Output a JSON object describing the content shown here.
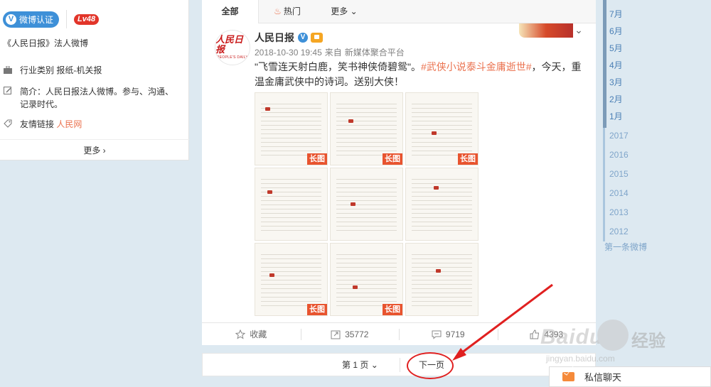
{
  "profile": {
    "verify_label": "微博认证",
    "level": "Lv48",
    "legal_desc": "《人民日报》法人微博",
    "industry_label": "行业类别",
    "industry_value": "报纸-机关报",
    "intro_label": "简介：",
    "intro_value": "人民日报法人微博。参与、沟通、记录时代。",
    "link_label": "友情链接",
    "link_value": "人民网",
    "more_label": "更多"
  },
  "tabs": [
    {
      "label": "全部"
    },
    {
      "label": "热门"
    },
    {
      "label": "更多"
    }
  ],
  "post": {
    "author": "人民日报",
    "avatar_logo": "人民日报",
    "avatar_sub": "PEOPLE'S DAILY",
    "time": "2018-10-30 19:45",
    "source_prefix": "来自",
    "source": "新媒体聚合平台",
    "text_before": "\"飞雪连天射白鹿，笑书神侠倚碧鸳\"。",
    "text_tag": "#武侠小说泰斗金庸逝世#",
    "text_after": "，今天，重温金庸武侠中的诗词。送别大侠！",
    "long_label": "长图",
    "images_count": 9
  },
  "actions": {
    "favorite": "收藏",
    "repost": "35772",
    "comment": "9719",
    "like": "4393"
  },
  "pager": {
    "page_label": "第 1 页",
    "next_label": "下一页"
  },
  "timeline": {
    "months": [
      "7月",
      "6月",
      "5月",
      "4月",
      "3月",
      "2月",
      "1月"
    ],
    "years": [
      "2017",
      "2016",
      "2015",
      "2014",
      "2013",
      "2012"
    ],
    "first_post": "第一条微博"
  },
  "chat": {
    "label": "私信聊天"
  },
  "watermark": {
    "text": "Baidu",
    "cn": "经验",
    "url": "jingyan.baidu.com"
  },
  "colors": {
    "accent": "#eb7350",
    "link_blue": "#4a7fb5",
    "verify_blue": "#3e90d8",
    "annotation_red": "#e02020"
  }
}
